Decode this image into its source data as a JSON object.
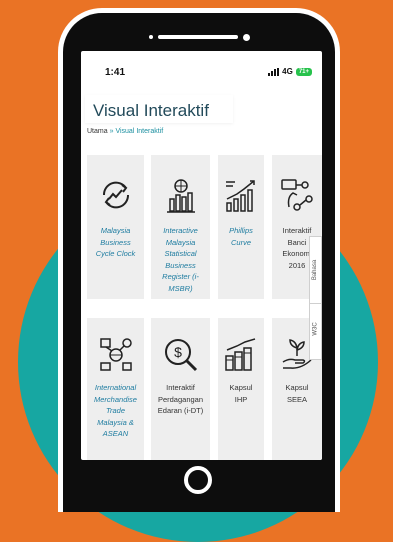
{
  "status_bar": {
    "time": "1:41",
    "network": "4G",
    "battery": "71+"
  },
  "page": {
    "title": "Visual Interaktif"
  },
  "breadcrumb": {
    "home": "Utama",
    "separator": "»",
    "current": "Visual Interaktif"
  },
  "cards": [
    {
      "icon": "business-cycle-icon",
      "label_lines": [
        "Malaysia",
        "Business",
        "Cycle Clock"
      ],
      "style": "italic"
    },
    {
      "icon": "building-chart-icon",
      "label_lines": [
        "Interactive",
        "Malaysia",
        "Statistical",
        "Business",
        "Register (i-",
        "MSBR)"
      ],
      "style": "italic"
    },
    {
      "icon": "growth-chart-icon",
      "label_lines": [
        "Phillips",
        "Curve"
      ],
      "style": "italic"
    },
    {
      "icon": "network-chart-icon",
      "label_lines": [
        "Interaktif",
        "Banci",
        "Ekonomi",
        "2016"
      ],
      "style": "plain"
    },
    {
      "icon": "trade-globe-icon",
      "label_lines": [
        "International",
        "Merchandise",
        "Trade",
        "Malaysia &",
        "ASEAN"
      ],
      "style": "italic"
    },
    {
      "icon": "money-search-icon",
      "label_lines": [
        "Interaktif",
        "Perdagangan",
        "Edaran (i-DT)"
      ],
      "style": "plain"
    },
    {
      "icon": "coin-stack-icon",
      "label_lines": [
        "Kapsul",
        "IHP"
      ],
      "style": "plain"
    },
    {
      "icon": "hand-plant-icon",
      "label_lines": [
        "Kapsul",
        "SEEA"
      ],
      "style": "plain"
    }
  ],
  "side_tabs": {
    "language": "Bahasa",
    "w3c": "W3C"
  },
  "colors": {
    "background": "#ea7325",
    "circle": "#17a7a2",
    "link": "#1e7ca0",
    "title": "#224a5a"
  }
}
